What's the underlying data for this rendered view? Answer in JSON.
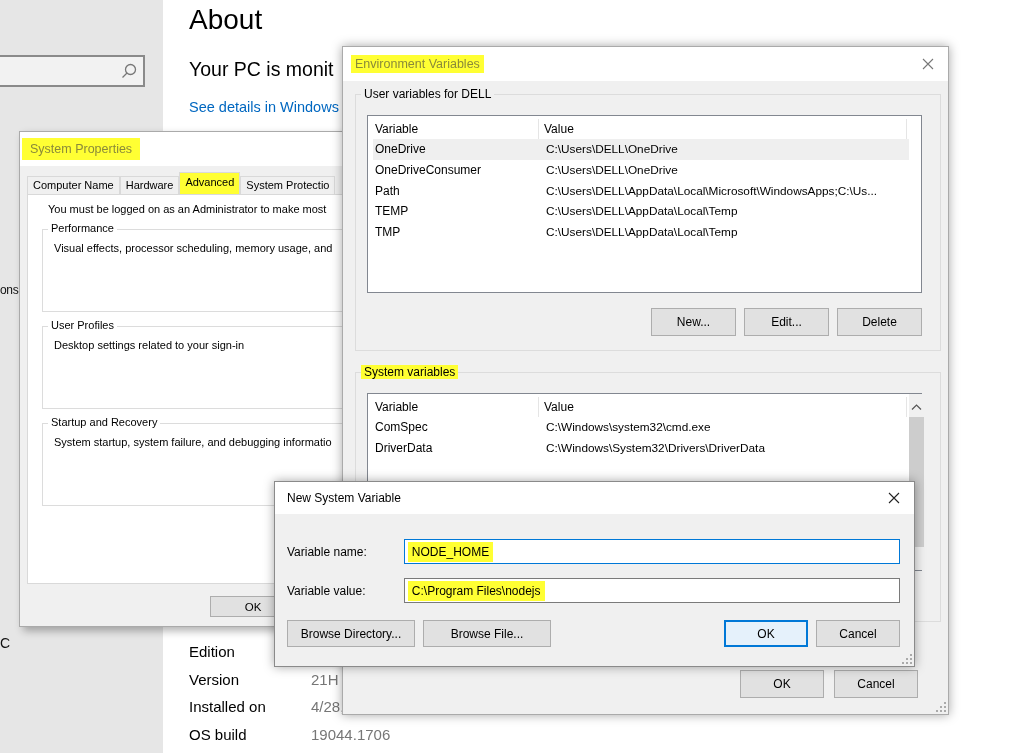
{
  "settings": {
    "sidebar_texts": [
      "ons",
      "C"
    ],
    "title": "About",
    "heading": "Your PC is monit",
    "link": "See details in Windows",
    "specs": [
      {
        "label": "Edition"
      },
      {
        "label": "Version",
        "value": "21H"
      },
      {
        "label": "Installed on",
        "value": "4/28,"
      },
      {
        "label": "OS build",
        "value": "19044.1706"
      }
    ]
  },
  "system_properties": {
    "title": "System Properties",
    "highlighted": true,
    "tabs": [
      {
        "label": "Computer Name",
        "selected": false,
        "highlighted": false
      },
      {
        "label": "Hardware",
        "selected": false,
        "highlighted": false
      },
      {
        "label": "Advanced",
        "selected": true,
        "highlighted": true
      },
      {
        "label": "System Protectio",
        "selected": false,
        "highlighted": false
      }
    ],
    "notice": "You must be logged on as an Administrator to make most",
    "groups": [
      {
        "title": "Performance",
        "text": "Visual effects, processor scheduling, memory usage, and"
      },
      {
        "title": "User Profiles",
        "text": "Desktop settings related to your sign-in"
      },
      {
        "title": "Startup and Recovery",
        "text": "System startup, system failure, and debugging informatio"
      }
    ],
    "buttons": [
      "OK"
    ]
  },
  "environment_variables": {
    "title": "Environment Variables",
    "highlighted": true,
    "user_variables": {
      "title": "User variables for DELL",
      "highlighted": false,
      "columns": [
        "Variable",
        "Value"
      ],
      "rows": [
        {
          "variable": "OneDrive",
          "value": "C:\\Users\\DELL\\OneDrive",
          "selected": true
        },
        {
          "variable": "OneDriveConsumer",
          "value": "C:\\Users\\DELL\\OneDrive",
          "selected": false
        },
        {
          "variable": "Path",
          "value": "C:\\Users\\DELL\\AppData\\Local\\Microsoft\\WindowsApps;C:\\Us...",
          "selected": false
        },
        {
          "variable": "TEMP",
          "value": "C:\\Users\\DELL\\AppData\\Local\\Temp",
          "selected": false
        },
        {
          "variable": "TMP",
          "value": "C:\\Users\\DELL\\AppData\\Local\\Temp",
          "selected": false
        }
      ],
      "buttons": [
        "New...",
        "Edit...",
        "Delete"
      ]
    },
    "system_variables": {
      "title": "System variables",
      "highlighted": true,
      "columns": [
        "Variable",
        "Value"
      ],
      "rows": [
        {
          "variable": "ComSpec",
          "value": "C:\\Windows\\system32\\cmd.exe",
          "selected": false
        },
        {
          "variable": "DriverData",
          "value": "C:\\Windows\\System32\\Drivers\\DriverData",
          "selected": false
        }
      ]
    },
    "buttons": [
      "OK",
      "Cancel"
    ]
  },
  "new_variable_dialog": {
    "title": "New System Variable",
    "fields": [
      {
        "label": "Variable name:",
        "value": "NODE_HOME",
        "highlighted": true
      },
      {
        "label": "Variable value:",
        "value": "C:\\Program Files\\nodejs",
        "highlighted": true
      }
    ],
    "buttons": [
      {
        "label": "Browse Directory...",
        "default": false
      },
      {
        "label": "Browse File...",
        "default": false
      },
      {
        "label": "OK",
        "default": true
      },
      {
        "label": "Cancel",
        "default": false
      }
    ]
  }
}
